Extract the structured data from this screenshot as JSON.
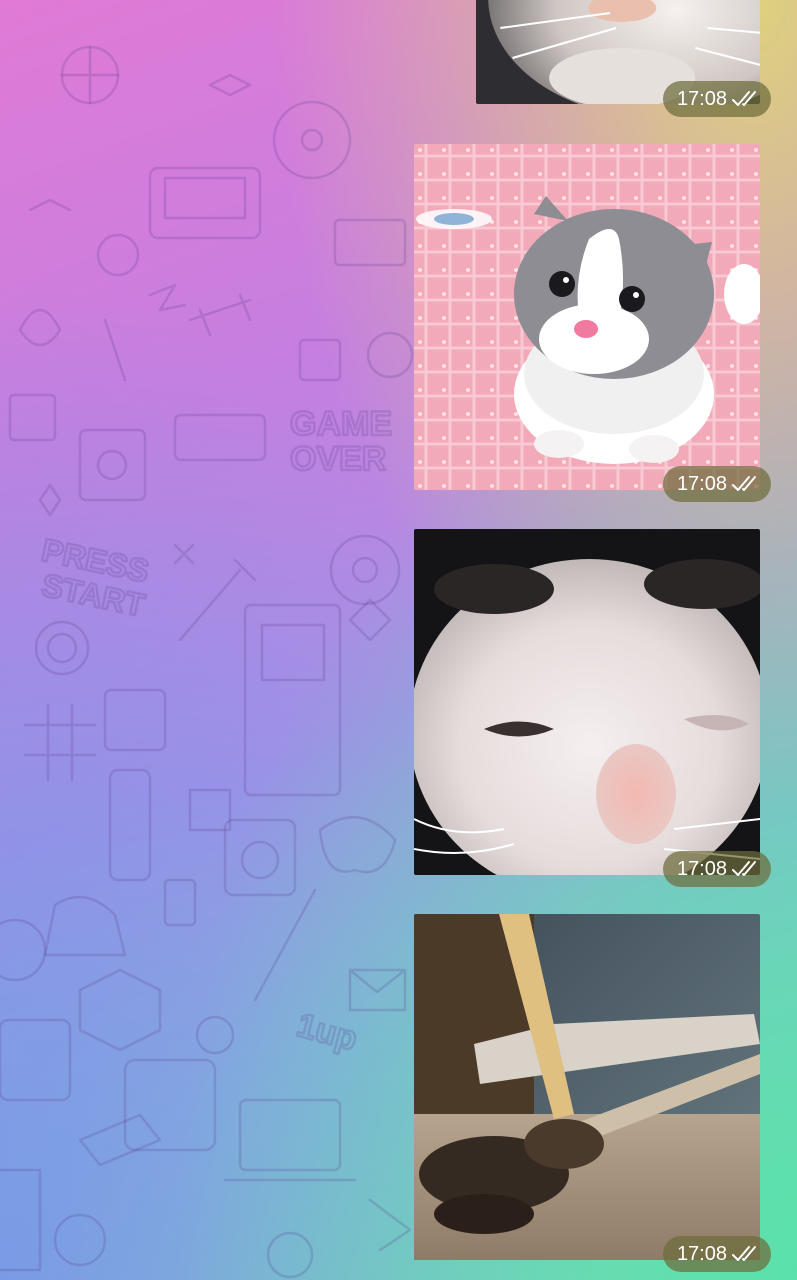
{
  "messages": [
    {
      "time": "17:08",
      "subject": "cat-closeup-chin",
      "status": "read-double-check-icon"
    },
    {
      "time": "17:08",
      "subject": "grey-white-kitten",
      "status": "read-double-check-icon"
    },
    {
      "time": "17:08",
      "subject": "white-cat-face",
      "status": "read-double-check-icon"
    },
    {
      "time": "17:08",
      "subject": "blurry-kitten-mirror",
      "status": "read-double-check-icon"
    }
  ],
  "doodle_texts": {
    "game_over_1": "GAME",
    "game_over_2": "OVER",
    "press_start_1": "PRESS",
    "press_start_2": "START",
    "one_up": "1up"
  },
  "colors": {
    "badge_bg": "#6e6c3c",
    "gradient_pink": "#e07ad6",
    "gradient_green": "#58e2aa",
    "gradient_yellow": "#ded678"
  }
}
